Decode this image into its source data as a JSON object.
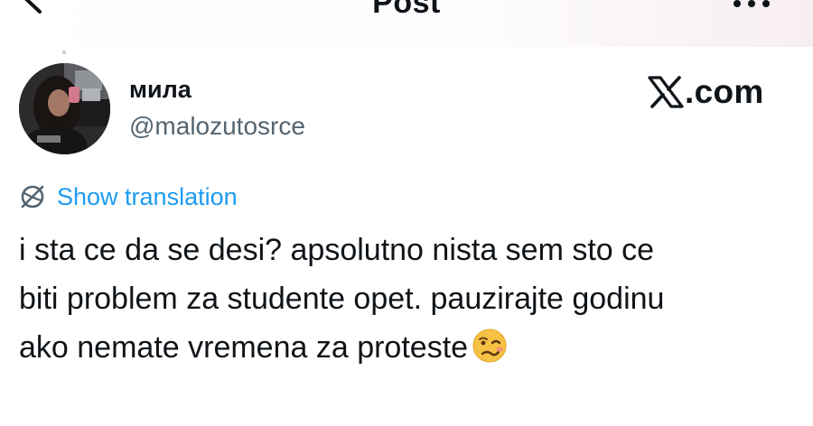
{
  "header": {
    "title": "Post",
    "back_icon": "arrow-left-icon",
    "more_icon": "more-horizontal-icon"
  },
  "post": {
    "author": {
      "display_name": "мила",
      "handle": "@malozutosrce",
      "avatar": "user-avatar-photo"
    },
    "brand": {
      "logo_icon": "x-logo-icon",
      "text": ".com"
    },
    "translate": {
      "label": "Show translation",
      "icon": "globe-translate-icon"
    },
    "text_lines": [
      "i sta ce da se desi? apsolutno nista sem sto ce",
      "biti problem za studente opet. pauzirajte godinu",
      "ako nemate vremena za proteste"
    ],
    "emoji": "woozy-face-emoji"
  },
  "colors": {
    "text": "#0f1419",
    "secondary": "#536471",
    "link": "#1d9bf0",
    "emoji": "#f6c245"
  }
}
